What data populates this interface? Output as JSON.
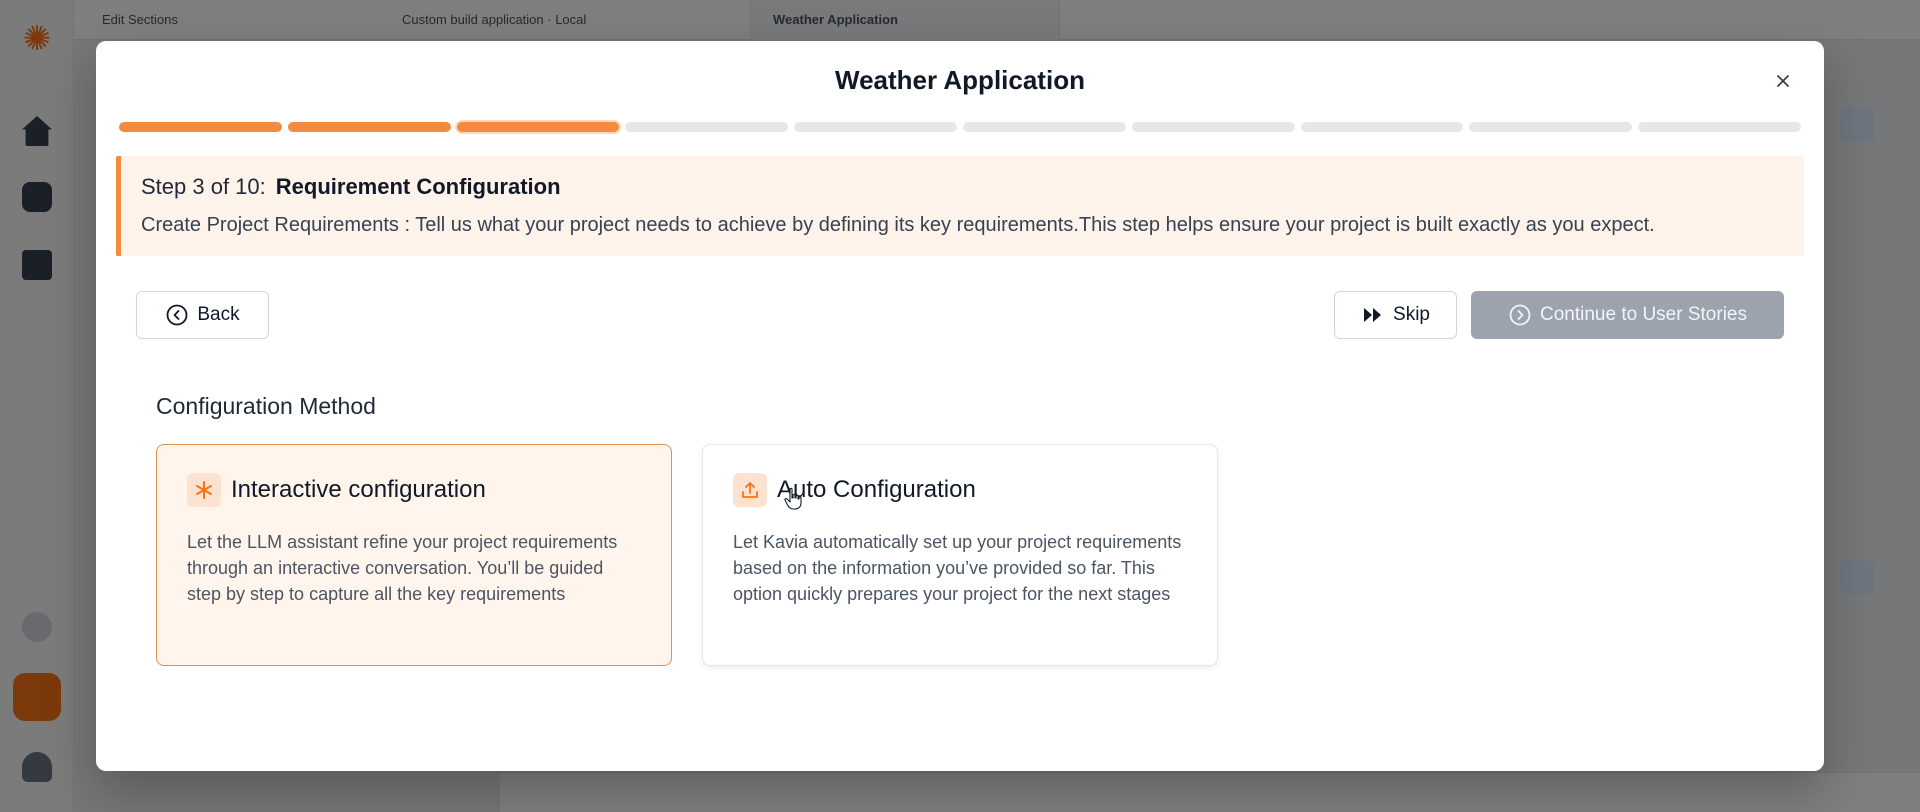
{
  "background": {
    "left_label": "Edit Sections",
    "center_label": "Custom build application · Local",
    "tab_label": "Weather Application"
  },
  "modal": {
    "title": "Weather Application",
    "close_icon": "close-icon"
  },
  "progress": {
    "total_steps": 10,
    "current_step": 3
  },
  "step": {
    "counter": "Step 3 of 10:",
    "name": "Requirement Configuration",
    "description": "Create Project Requirements : Tell us what your project needs to achieve by defining its key requirements.This step helps ensure your project is built exactly as you expect."
  },
  "actions": {
    "back_label": "Back",
    "skip_label": "Skip",
    "continue_label": "Continue to User Stories"
  },
  "config": {
    "section_title": "Configuration Method",
    "options": [
      {
        "title": "Interactive configuration",
        "description": "Let the LLM assistant refine your project requirements through an interactive conversation. You’ll be guided step by step to capture all the key requirements",
        "icon": "asterisk-icon",
        "selected": true
      },
      {
        "title": "Auto Configuration",
        "description": "Let Kavia automatically set up your project requirements based on the information you’ve provided so far. This option quickly prepares your project for the next stages",
        "icon": "upload-icon",
        "selected": false
      }
    ]
  },
  "colors": {
    "accent": "#f28b40",
    "banner_bg": "#fef3ea",
    "disabled_button": "#9ca3af"
  }
}
